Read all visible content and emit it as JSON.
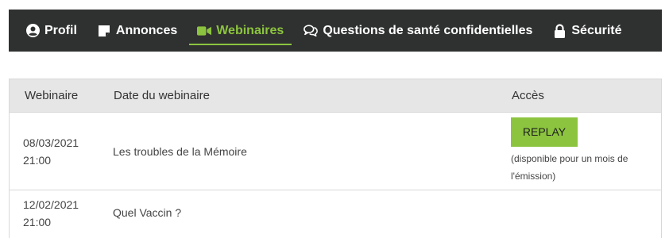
{
  "nav": {
    "items": [
      {
        "label": "Profil",
        "icon": "user-circle-icon"
      },
      {
        "label": "Annonces",
        "icon": "note-icon"
      },
      {
        "label": "Webinaires",
        "icon": "video-camera-icon",
        "active": true
      },
      {
        "label": "Questions de santé confidentielles",
        "icon": "chat-bubbles-icon"
      },
      {
        "label": "Sécurité",
        "icon": "lock-icon"
      }
    ],
    "colors": {
      "background": "#2f3030",
      "text": "#ffffff",
      "active": "#8cc43f"
    }
  },
  "table": {
    "headers": [
      "Webinaire",
      "Date du webinaire",
      "Accès"
    ],
    "rows": [
      {
        "date": "08/03/2021",
        "time": "21:00",
        "title": "Les troubles de la Mémoire",
        "access_button": "REPLAY",
        "access_note": "(disponible pour un mois de l'émission)"
      },
      {
        "date": "12/02/2021",
        "time": "21:00",
        "title": "Quel Vaccin ?"
      }
    ]
  }
}
